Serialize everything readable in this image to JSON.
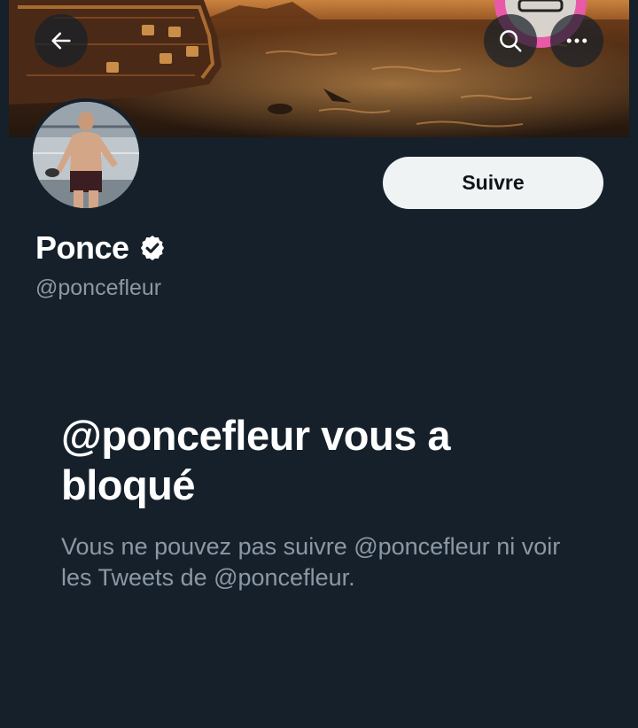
{
  "header": {
    "back_icon": "arrow-left-icon",
    "search_icon": "search-icon",
    "more_icon": "more-horizontal-icon"
  },
  "profile": {
    "display_name": "Ponce",
    "verified": true,
    "handle": "@poncefleur",
    "follow_label": "Suivre"
  },
  "blocked": {
    "title": "@poncefleur vous a bloqué",
    "description": "Vous ne pouvez pas suivre @poncefleur ni voir les Tweets de @poncefleur."
  },
  "colors": {
    "background": "#15202b",
    "text_primary": "#ffffff",
    "text_secondary": "#8b98a5",
    "follow_button_bg": "#eff3f4",
    "follow_button_text": "#0f1419"
  }
}
